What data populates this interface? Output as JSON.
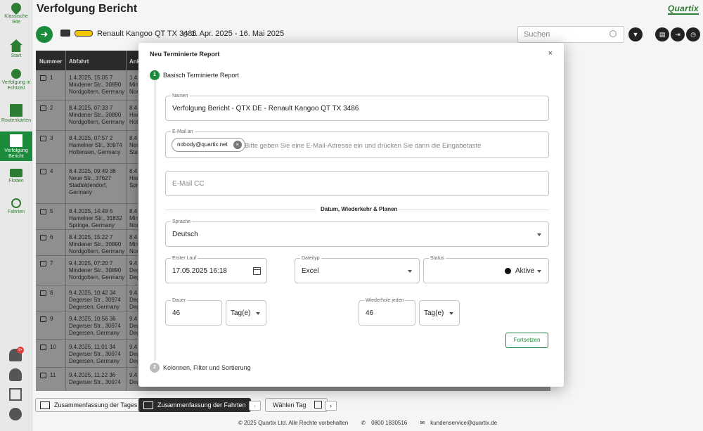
{
  "app": {
    "title": "Verfolgung Bericht",
    "logo": "Quartix"
  },
  "colors": {
    "accent": "#1b8a3a",
    "header_dark": "#2a2a2a"
  },
  "sidebar": {
    "items": [
      {
        "label": "Klassische Site",
        "icon": "map-pin-icon"
      },
      {
        "label": "Start",
        "icon": "home-icon"
      },
      {
        "label": "Verfolgung in Echtzeit",
        "icon": "live-tracking-icon"
      },
      {
        "label": "Routenkarten",
        "icon": "route-map-icon"
      },
      {
        "label": "Verfolgung Bericht",
        "icon": "report-icon",
        "active": true
      },
      {
        "label": "Flotten",
        "icon": "truck-icon"
      },
      {
        "label": "Fahrten",
        "icon": "trips-icon"
      }
    ],
    "notification_badge": "9+"
  },
  "toolbar": {
    "vehicle": "Renault Kangoo QT TX 3486",
    "date_range": "1. Apr. 2025  -  16. Mai 2025",
    "search_placeholder": "Suchen"
  },
  "table": {
    "headers": [
      "Nummer",
      "Abfahrt",
      "Ank"
    ],
    "rows": [
      {
        "num": "1",
        "departure": [
          "1.4.2025, 15:05 7",
          "Mindener Str., 30890",
          "Nordgoltern, Germany"
        ],
        "arrival": [
          "1.4.",
          "Min",
          "Nor"
        ]
      },
      {
        "num": "2",
        "departure": [
          "8.4.2025, 07:33 7",
          "Mindener Str., 30890",
          "Nordgoltern, Germany"
        ],
        "arrival": [
          "8.4.",
          "Ham",
          "Holt"
        ]
      },
      {
        "num": "3",
        "departure": [
          "8.4.2025, 07:57 2",
          "Hamelner Str., 30974",
          "Holtensen, Germany"
        ],
        "arrival": [
          "8.4.",
          "Neu",
          "Sta"
        ]
      },
      {
        "num": "4",
        "departure": [
          "8.4.2025, 09:49 38",
          "Neue Str., 37627",
          "Stadtoldendorf,",
          "Germany"
        ],
        "arrival": [
          "8.4.",
          "Ham",
          "Spri"
        ]
      },
      {
        "num": "5",
        "departure": [
          "8.4.2025, 14:49 6",
          "Hamelner Str., 31832",
          "Springe, Germany"
        ],
        "arrival": [
          "8.4.",
          "Min",
          "Nor"
        ]
      },
      {
        "num": "6",
        "departure": [
          "8.4.2025, 15:22 7",
          "Mindener Str., 30890",
          "Nordgoltern, Germany"
        ],
        "arrival": [
          "8.4.",
          "Min",
          "Nor"
        ]
      },
      {
        "num": "7",
        "departure": [
          "9.4.2025, 07:20 7",
          "Mindener Str., 30890",
          "Nordgoltern, Germany"
        ],
        "arrival": [
          "9.4.",
          "Deg",
          "Deg"
        ]
      },
      {
        "num": "8",
        "departure": [
          "9.4.2025, 10:42 34",
          "Degerser Str., 30974",
          "Degersen, Germany"
        ],
        "arrival": [
          "9.4.",
          "Deg",
          "Deg"
        ]
      },
      {
        "num": "9",
        "departure": [
          "9.4.2025, 10:56 36",
          "Degerser Str., 30974",
          "Degersen, Germany"
        ],
        "arrival": [
          "9.4.",
          "Deg",
          "Deg"
        ]
      },
      {
        "num": "10",
        "departure": [
          "9.4.2025, 11:01 34",
          "Degerser Str., 30974",
          "Degersen, Germany"
        ],
        "arrival": [
          "9.4.",
          "Deg",
          "Deg"
        ]
      },
      {
        "num": "11",
        "departure": [
          "9.4.2025, 11:22 36",
          "Degerser Str., 30974"
        ],
        "arrival": [
          "9.4.",
          "Deg"
        ]
      }
    ]
  },
  "bottom": {
    "summary_day": "Zusammenfassung der Tages",
    "summary_trips": "Zusammenfassung der Fahrten",
    "select_day": "Wählen Tag",
    "prev": "‹",
    "next": "›"
  },
  "footer": {
    "copyright": "© 2025 Quartix Ltd. Alle Rechte vorbehalten",
    "phone": "0800 1830516",
    "email": "kundenservice@quartix.de"
  },
  "modal": {
    "title": "Neu Terminierte Report",
    "close": "×",
    "step1": {
      "number": "1",
      "label": "Basisch Terminierte Report"
    },
    "step2": {
      "number": "2",
      "label": "Kolonnen, Filter und Sortierung"
    },
    "name": {
      "label": "Namen",
      "value": "Verfolgung Bericht - QTX DE - Renault Kangoo QT TX 3486"
    },
    "email": {
      "label": "E-Mail an",
      "chip": "nobody@quartix.net",
      "placeholder": "Bitte geben Sie eine E-Mail-Adresse ein und drücken Sie dann die Eingabetaste"
    },
    "email_cc": {
      "placeholder": "E-Mail CC"
    },
    "section": "Datum, Wiederkehr & Planen",
    "language": {
      "label": "Sprache",
      "value": "Deutsch"
    },
    "first_run": {
      "label": "Erster Lauf",
      "value": "17.05.2025 16:18"
    },
    "filetype": {
      "label": "Dateityp",
      "value": "Excel"
    },
    "status": {
      "label": "Status",
      "value": "Aktive"
    },
    "duration": {
      "label": "Dauer",
      "value": "46",
      "unit": "Tag(e)"
    },
    "repeat": {
      "label": "Wiederhole jeden",
      "value": "46",
      "unit": "Tag(e)"
    },
    "continue": "Fortsetzen"
  }
}
